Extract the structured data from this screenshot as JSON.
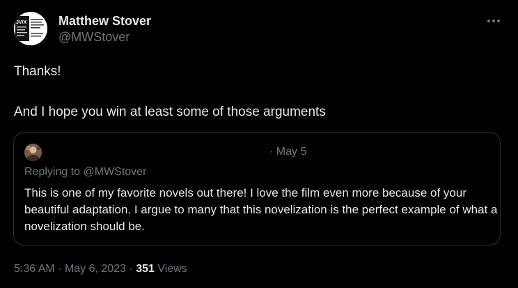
{
  "tweet": {
    "author": {
      "display_name": "Matthew Stover",
      "handle": "@MWStover",
      "avatar_icon": "book-cover-avatar",
      "avatar_text": "JV/X"
    },
    "more_icon": "more-options-icon",
    "text_line1": "Thanks!",
    "text_line2": "And I hope you win at least some of those arguments",
    "quoted": {
      "avatar_icon": "user-avatar",
      "date": "· May 5",
      "replying_to": "Replying to @MWStover",
      "text": "This is one of my favorite novels out there! I love the film even more because of your beautiful adaptation. I argue to many that this novelization is the perfect example of what a novelization should be."
    },
    "meta": {
      "time": "5:36 AM",
      "sep1": "·",
      "date": "May 6, 2023",
      "sep2": "·",
      "views_count": "351",
      "views_label": "Views"
    }
  },
  "colors": {
    "background": "#000000",
    "primary_text": "#e7e9ea",
    "secondary_text": "#71767b",
    "border": "#2f3336"
  }
}
